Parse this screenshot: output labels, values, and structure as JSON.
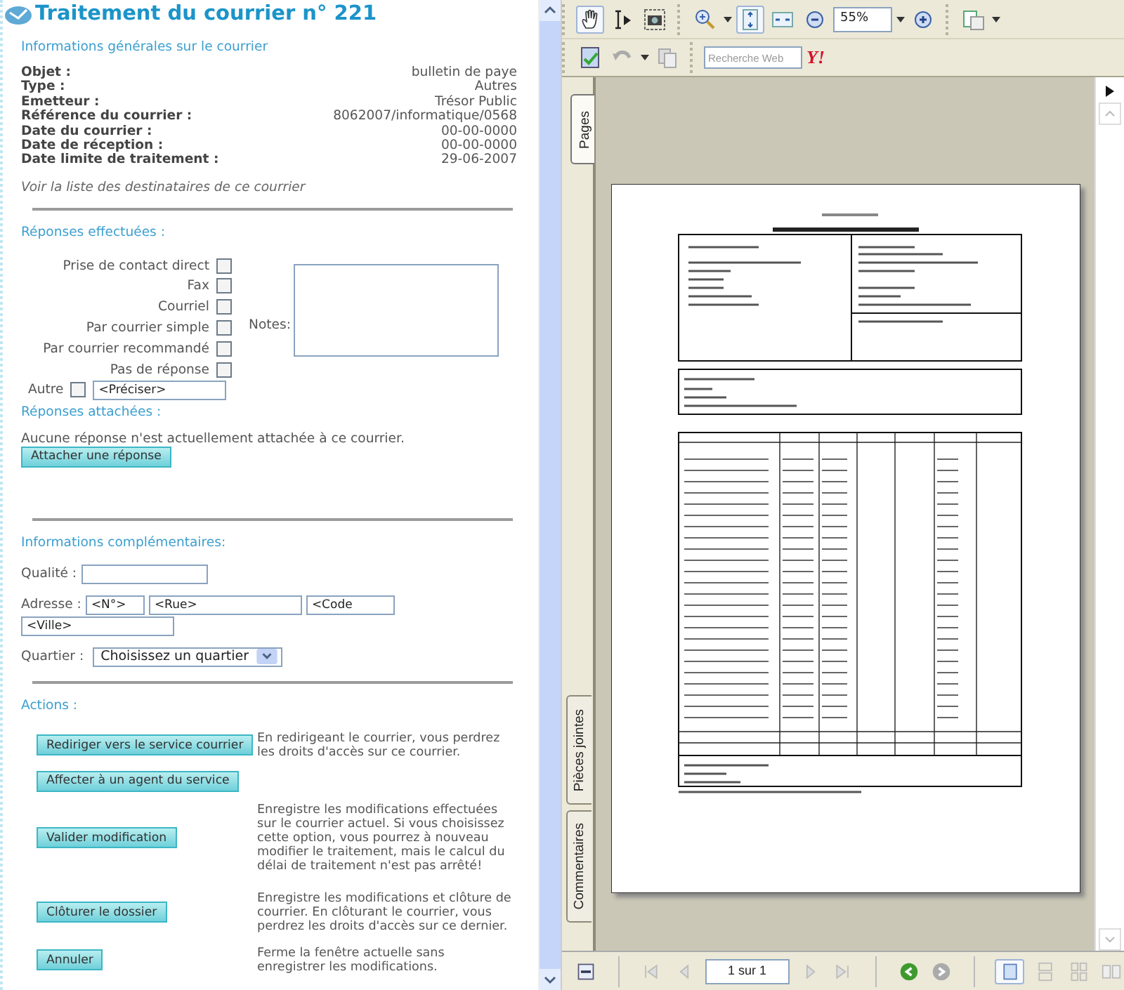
{
  "title": "Traitement du courrier n° 221",
  "general": {
    "heading": "Informations générales sur le courrier",
    "fields": [
      {
        "label": "Objet :",
        "value": "bulletin de paye"
      },
      {
        "label": "Type :",
        "value": "Autres"
      },
      {
        "label": "Emetteur :",
        "value": "Trésor Public"
      },
      {
        "label": "Référence du courrier :",
        "value": "8062007/informatique/0568"
      },
      {
        "label": "Date du courrier :",
        "value": "00-00-0000"
      },
      {
        "label": "Date de réception :",
        "value": "00-00-0000"
      },
      {
        "label": "Date limite de traitement :",
        "value": "29-06-2007"
      }
    ],
    "link": "Voir la liste des destinataires de ce courrier"
  },
  "responses": {
    "heading": "Réponses effectuées :",
    "options": [
      {
        "label": "Prise de contact direct",
        "checked": false
      },
      {
        "label": "Fax",
        "checked": false
      },
      {
        "label": "Courriel",
        "checked": false
      },
      {
        "label": "Par courrier simple",
        "checked": false
      },
      {
        "label": "Par courrier recommandé",
        "checked": false
      },
      {
        "label": "Pas de réponse",
        "checked": false
      }
    ],
    "other": {
      "label": "Autre",
      "checked": false,
      "value": "<Préciser>"
    },
    "notes_label": "Notes:"
  },
  "attached": {
    "heading": "Réponses attachées :",
    "message": "Aucune réponse n'est actuellement attachée à ce courrier.",
    "button": "Attacher une réponse"
  },
  "extra": {
    "heading": "Informations complémentaires:",
    "quality_label": "Qualité :",
    "address_label": "Adresse :",
    "address_fields": [
      {
        "value": "<N°>"
      },
      {
        "value": "<Rue>"
      },
      {
        "value": "<Code"
      },
      {
        "value": "<Ville>"
      }
    ],
    "district_label": "Quartier :",
    "district_select": "Choisissez un quartier"
  },
  "actions": {
    "heading": "Actions :",
    "items": [
      {
        "button": "Rediriger vers le service courrier",
        "description": "En redirigeant le courrier, vous perdrez les droits d'accès sur ce courrier."
      },
      {
        "button": "Affecter à un agent du service"
      },
      {
        "button": "Valider modification",
        "description": "Enregistre les modifications effectuées sur le courrier actuel. Si vous choisissez cette option, vous pourrez à nouveau modifier le traitement, mais le calcul du délai de traitement n'est pas arrêté!"
      },
      {
        "button": "Clôturer  le dossier",
        "description": "Enregistre les modifications et clôture de courrier. En clôturant le courrier, vous perdrez les droits d'accès sur ce dernier."
      },
      {
        "button": "Annuler",
        "description": "Ferme la fenêtre actuelle sans enregistrer les modifications."
      }
    ]
  },
  "viewer": {
    "zoom": "55%",
    "search_placeholder": "Recherche Web",
    "search_logo": "Y!",
    "side_tabs": [
      {
        "label": "Pages",
        "selected": true
      },
      {
        "label": "Pièces jointes",
        "selected": false
      },
      {
        "label": "Commentaires",
        "selected": false
      }
    ],
    "page_field": "1 sur 1"
  }
}
